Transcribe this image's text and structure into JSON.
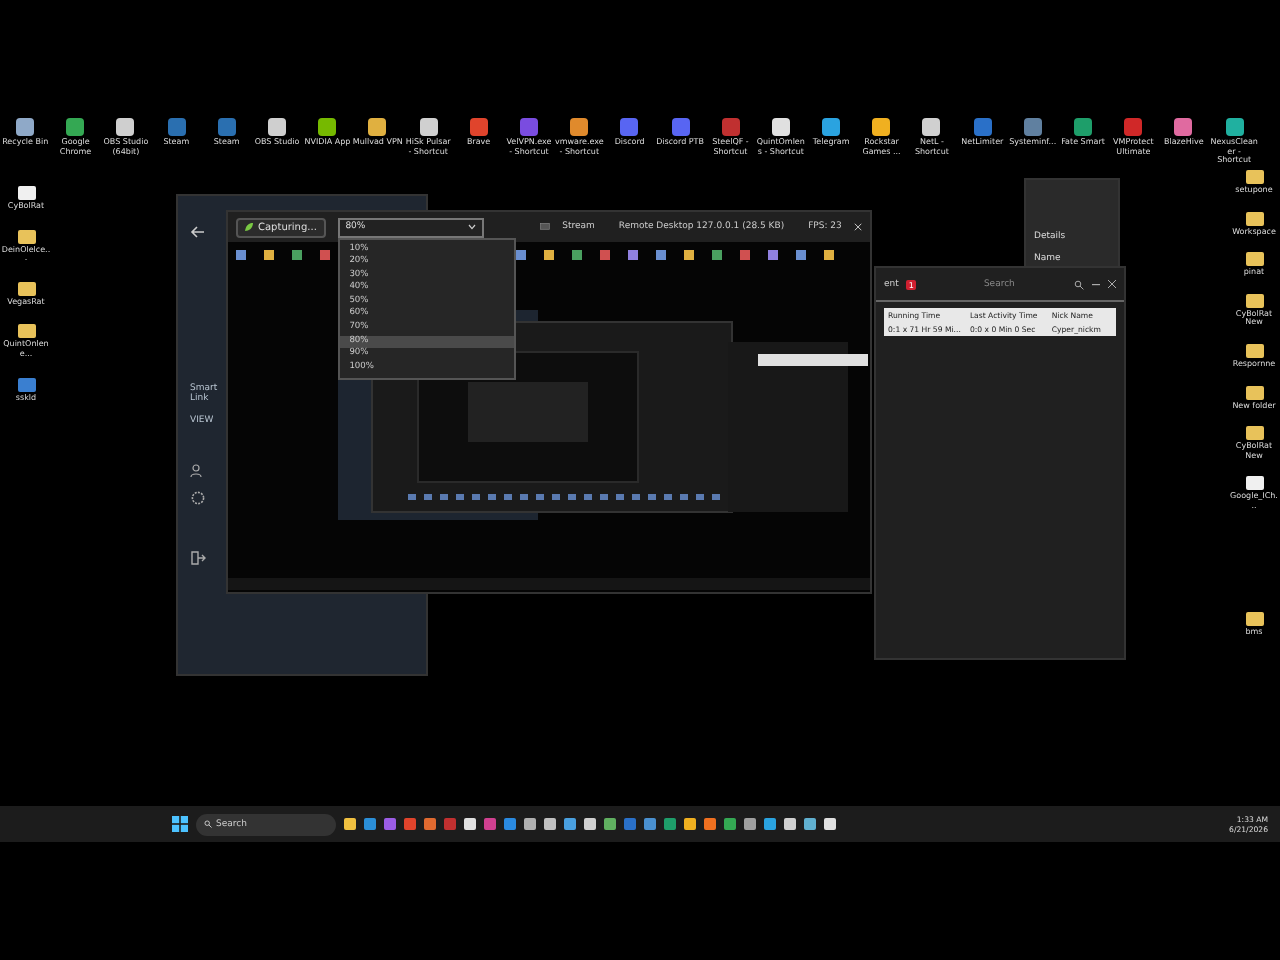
{
  "desktop_top": [
    {
      "label": "Recycle Bin",
      "color": "#8fa9c8"
    },
    {
      "label": "Google Chrome",
      "color": "#34a853"
    },
    {
      "label": "OBS Studio (64bit)",
      "color": "#cfcfcf"
    },
    {
      "label": "Steam",
      "color": "#2a6fb0"
    },
    {
      "label": "Steam",
      "color": "#2a6fb0"
    },
    {
      "label": "OBS Studio",
      "color": "#cfcfcf"
    },
    {
      "label": "NVIDIA App",
      "color": "#76b900"
    },
    {
      "label": "Mullvad VPN",
      "color": "#e0b040"
    },
    {
      "label": "HiSk Pulsar - Shortcut",
      "color": "#d0d0d0"
    },
    {
      "label": "Brave",
      "color": "#e0442c"
    },
    {
      "label": "VelVPN.exe - Shortcut",
      "color": "#7a4ce0"
    },
    {
      "label": "vmware.exe - Shortcut",
      "color": "#e08a2c"
    },
    {
      "label": "Discord",
      "color": "#5865f2"
    },
    {
      "label": "Discord PTB",
      "color": "#5865f2"
    },
    {
      "label": "SteelQF - Shortcut",
      "color": "#c03030"
    },
    {
      "label": "QuintOmlens - Shortcut",
      "color": "#e0e0e0"
    },
    {
      "label": "Telegram",
      "color": "#2aa3e0"
    },
    {
      "label": "Rockstar Games ...",
      "color": "#f0b020"
    },
    {
      "label": "NetL - Shortcut",
      "color": "#d0d0d0"
    },
    {
      "label": "NetLimiter",
      "color": "#2a70c8"
    },
    {
      "label": "Systeminf...",
      "color": "#6080a0"
    },
    {
      "label": "Fate Smart",
      "color": "#1e9e6a"
    },
    {
      "label": "VMProtect Ultimate",
      "color": "#d02828"
    },
    {
      "label": "BlazeHive",
      "color": "#e06aa0"
    },
    {
      "label": "NexusCleaner - Shortcut",
      "color": "#20b0a0"
    }
  ],
  "desktop_left": [
    {
      "label": "CyBolRat",
      "kind": "file"
    },
    {
      "label": "DeinOlelce...",
      "kind": "folder"
    },
    {
      "label": "VegasRat",
      "kind": "folder"
    },
    {
      "label": "QuintOnlene...",
      "kind": "folder"
    },
    {
      "label": "sskld",
      "kind": "app"
    }
  ],
  "desktop_right": [
    {
      "label": "setupone",
      "kind": "folder"
    },
    {
      "label": "Workspace",
      "kind": "folder"
    },
    {
      "label": "pinat",
      "kind": "folder"
    },
    {
      "label": "CyBolRat New",
      "kind": "folder"
    },
    {
      "label": "Respornne",
      "kind": "folder"
    },
    {
      "label": "New folder",
      "kind": "folder"
    },
    {
      "label": "CyBolRat New",
      "kind": "folder"
    },
    {
      "label": "Google_ICh...",
      "kind": "file"
    },
    {
      "label": "bms",
      "kind": "folder"
    }
  ],
  "remote_app": {
    "sidebar_labels": [
      "Smart Link",
      "VIEW"
    ],
    "capture_button": "Capturing...",
    "quality": {
      "value": "80%",
      "options": [
        {
          "label": "10%",
          "selected": false
        },
        {
          "label": "20%",
          "selected": false
        },
        {
          "label": "30%",
          "selected": false
        },
        {
          "label": "40%",
          "selected": false
        },
        {
          "label": "50%",
          "selected": false
        },
        {
          "label": "60%",
          "selected": false
        },
        {
          "label": "70%",
          "selected": false
        },
        {
          "label": "80%",
          "selected": true
        },
        {
          "label": "90%",
          "selected": false
        },
        {
          "label": "100%",
          "selected": false
        }
      ]
    },
    "stream_label": "Stream",
    "title": "Remote Desktop 127.0.0.1 (28.5 KB)",
    "fps": "FPS: 23"
  },
  "explorer": {
    "details": "Details",
    "column": "Name"
  },
  "clients_window": {
    "tab_label": "ent",
    "badge": "1",
    "search_placeholder": "Search",
    "columns": [
      "Running Time",
      "Last Activity Time",
      "Nick Name"
    ],
    "rows": [
      [
        "0:1 x 71 Hr 59 Mi...",
        "0:0 x 0 Min 0 Sec",
        "Cyper_nickm"
      ]
    ]
  },
  "taskbar": {
    "search_placeholder": "Search",
    "time": "1:33 AM",
    "date": "6/21/2026",
    "apps": [
      {
        "color": "#f0c040"
      },
      {
        "color": "#2b8fd8"
      },
      {
        "color": "#9b5de5"
      },
      {
        "color": "#e0442c"
      },
      {
        "color": "#e06a30"
      },
      {
        "color": "#c03030"
      },
      {
        "color": "#e0e0e0"
      },
      {
        "color": "#d04090"
      },
      {
        "color": "#2a8ae0"
      },
      {
        "color": "#b0b0b0"
      },
      {
        "color": "#c0c0c0"
      },
      {
        "color": "#4aa0e0"
      },
      {
        "color": "#d0d0d0"
      },
      {
        "color": "#60b060"
      },
      {
        "color": "#2a70c8"
      },
      {
        "color": "#4a90d0"
      },
      {
        "color": "#1e9e6a"
      },
      {
        "color": "#f0b020"
      },
      {
        "color": "#f07020"
      },
      {
        "color": "#34a853"
      },
      {
        "color": "#a0a0a0"
      },
      {
        "color": "#2aa3e0"
      },
      {
        "color": "#d0d0d0"
      },
      {
        "color": "#60b0d0"
      },
      {
        "color": "#e0e0e0"
      }
    ]
  }
}
